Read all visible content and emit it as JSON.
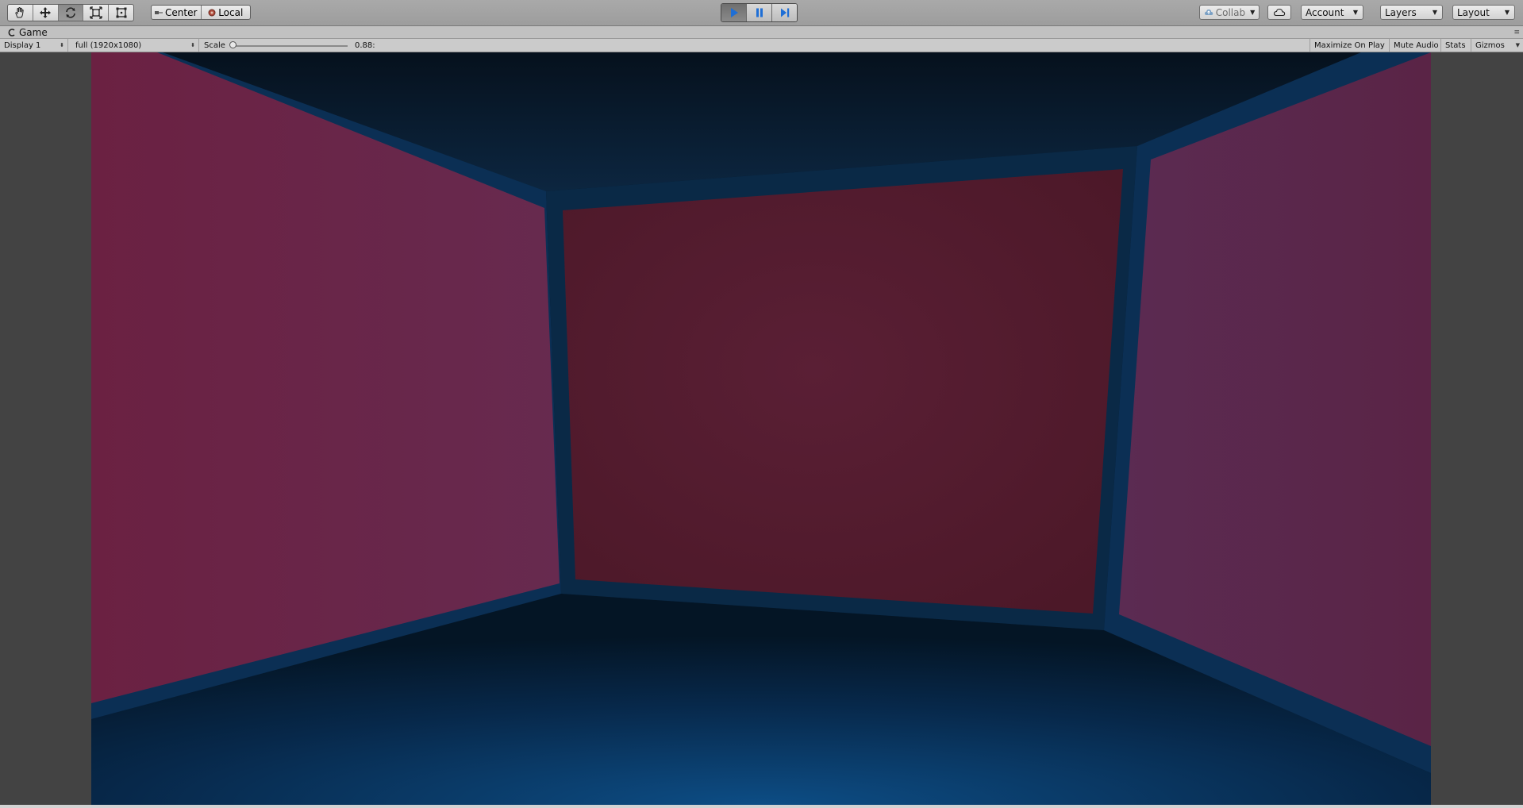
{
  "toolbar": {
    "tools": [
      {
        "name": "hand-tool",
        "icon": "hand-icon"
      },
      {
        "name": "move-tool",
        "icon": "move-icon"
      },
      {
        "name": "rotate-tool",
        "icon": "rotate-icon"
      },
      {
        "name": "scale-tool",
        "icon": "scale-icon"
      },
      {
        "name": "rect-tool",
        "icon": "rect-transform-icon"
      }
    ],
    "active_tool": "rotate-tool",
    "pivot_label": "Center",
    "space_label": "Local",
    "playback": {
      "play_active": true,
      "pause_active": true,
      "accent_color": "#1f6fd6"
    },
    "collab_label": "Collab",
    "account_label": "Account",
    "layers_label": "Layers",
    "layout_label": "Layout"
  },
  "game_tab": {
    "label": "Game",
    "icon": "game-controller-icon"
  },
  "game_toolbar": {
    "display_label": "Display 1",
    "resolution_label": "full (1920x1080)",
    "scale_label": "Scale",
    "scale_value_label": "0.88:",
    "maximize_label": "Maximize On Play",
    "mute_label": "Mute Audio",
    "stats_label": "Stats",
    "gizmos_label": "Gizmos"
  },
  "scene": {
    "left_wall_color": "#6b2344",
    "back_wall_color": "#541c2e",
    "right_wall_color": "#5c2a4e",
    "frame_color": "#0b2f54",
    "floor_color": "#0b3a66"
  }
}
